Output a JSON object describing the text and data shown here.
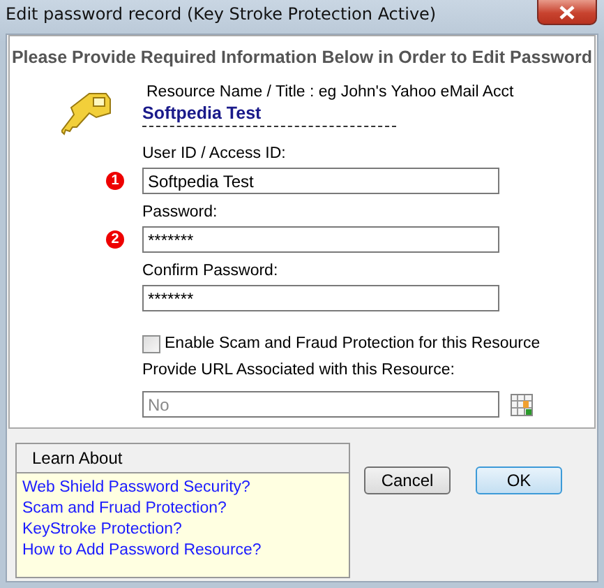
{
  "window": {
    "title": "Edit password record (Key Stroke Protection Active)"
  },
  "heading": "Please Provide Required Information Below in Order to Edit Password",
  "resource": {
    "label": "Resource Name / Title : eg John's Yahoo eMail Acct",
    "value": "Softpedia Test"
  },
  "fields": [
    {
      "label": "User ID / Access ID:",
      "value": "Softpedia Test",
      "badge": "1"
    },
    {
      "label": "Password:",
      "value": "*******",
      "badge": "2"
    },
    {
      "label": "Confirm Password:",
      "value": "*******"
    }
  ],
  "scam_protection": {
    "label": "Enable Scam and Fraud Protection for this Resource",
    "checked": false
  },
  "url": {
    "label": "Provide URL Associated with this Resource:",
    "value": "No",
    "disabled": true
  },
  "learn_about": {
    "title": "Learn About",
    "links": [
      "Web Shield Password Security?",
      "Scam and Fruad Protection?",
      "KeyStroke Protection?",
      "How to Add Password Resource?"
    ]
  },
  "buttons": [
    {
      "label": "Cancel",
      "default": false
    },
    {
      "label": "OK",
      "default": true
    }
  ]
}
